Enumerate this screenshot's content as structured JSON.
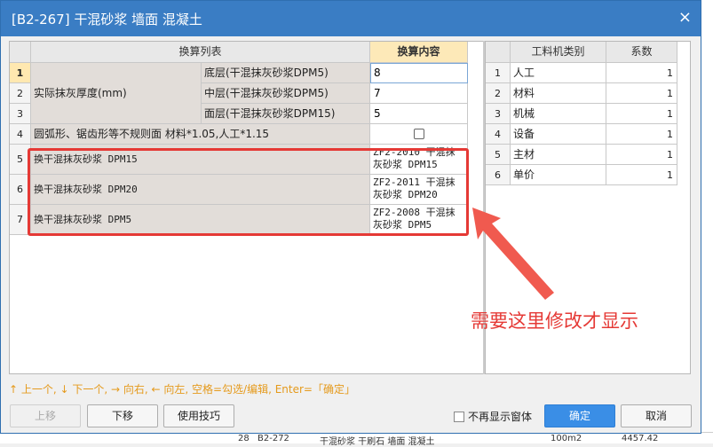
{
  "dialog": {
    "title": "[B2-267] 干混砂浆 墙面 混凝土",
    "close_glyph": "×"
  },
  "left_table": {
    "col1_header": "换算列表",
    "col2_header": "换算内容",
    "group_label": "实际抹灰厚度(mm)",
    "rows": [
      {
        "num": "1",
        "label": "底层(干混抹灰砂浆DPM5)",
        "value": "8"
      },
      {
        "num": "2",
        "label": "中层(干混抹灰砂浆DPM5)",
        "value": "7"
      },
      {
        "num": "3",
        "label": "面层(干混抹灰砂浆DPM15)",
        "value": "5"
      },
      {
        "num": "4",
        "label": "圆弧形、锯齿形等不规则面 材料*1.05,人工*1.15",
        "value": ""
      },
      {
        "num": "5",
        "label": "换干混抹灰砂浆 DPM15",
        "value_l1": "ZF2-2010  干混抹",
        "value_l2": "灰砂浆 DPM15"
      },
      {
        "num": "6",
        "label": "换干混抹灰砂浆 DPM20",
        "value_l1": "ZF2-2011  干混抹",
        "value_l2": "灰砂浆 DPM20"
      },
      {
        "num": "7",
        "label": "换干混抹灰砂浆 DPM5",
        "value_l1": "ZF2-2008  干混抹",
        "value_l2": "灰砂浆 DPM5"
      }
    ]
  },
  "right_table": {
    "col1_header": "工料机类别",
    "col2_header": "系数",
    "rows": [
      {
        "num": "1",
        "category": "人工",
        "factor": "1"
      },
      {
        "num": "2",
        "category": "材料",
        "factor": "1"
      },
      {
        "num": "3",
        "category": "机械",
        "factor": "1"
      },
      {
        "num": "4",
        "category": "设备",
        "factor": "1"
      },
      {
        "num": "5",
        "category": "主材",
        "factor": "1"
      },
      {
        "num": "6",
        "category": "单价",
        "factor": "1"
      }
    ]
  },
  "hint": "↑ 上一个, ↓ 下一个, → 向右, ← 向左, 空格=勾选/编辑, Enter=「确定」",
  "buttons": {
    "move_up": "上移",
    "move_down": "下移",
    "tips": "使用技巧",
    "ok": "确定",
    "cancel": "取消"
  },
  "no_show_label": "不再显示窗体",
  "annotation": "需要这里修改才显示",
  "background_row": {
    "num": "28",
    "code": "B2-272",
    "name": "干混砂浆 干刷石 墙面 混凝土",
    "unit": "100m2",
    "amount": "4457.42"
  },
  "colors": {
    "title_bar": "#3a7dc4",
    "highlight": "#e53935",
    "hint_text": "#e59a1c",
    "primary_button": "#3a8ee6"
  }
}
